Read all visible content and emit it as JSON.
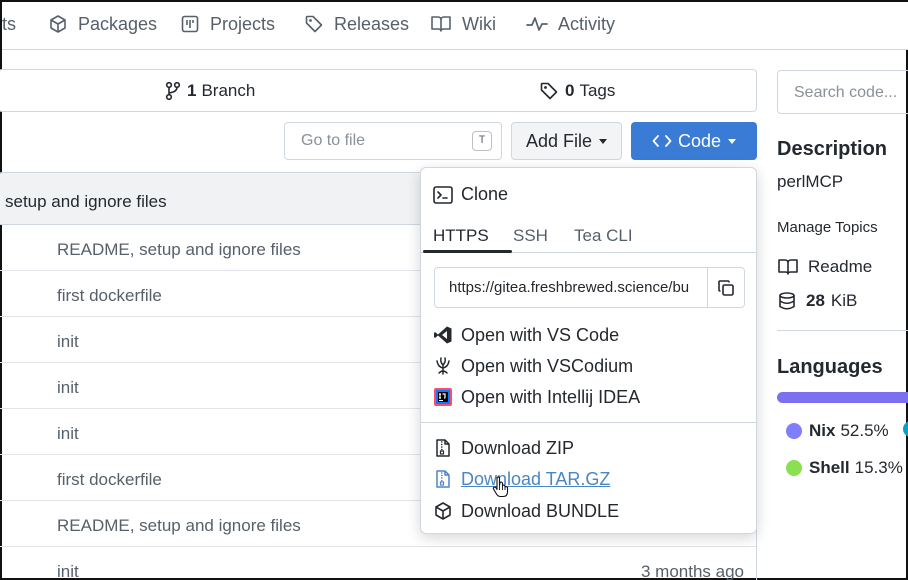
{
  "nav": {
    "items": [
      {
        "label": "ts",
        "icon": "code-icon"
      },
      {
        "label": "Packages",
        "icon": "package-icon"
      },
      {
        "label": "Projects",
        "icon": "project-icon"
      },
      {
        "label": "Releases",
        "icon": "tag-icon"
      },
      {
        "label": "Wiki",
        "icon": "book-icon"
      },
      {
        "label": "Activity",
        "icon": "pulse-icon"
      }
    ]
  },
  "refs": {
    "branch_count": "1",
    "branch_label": "Branch",
    "tag_count": "0",
    "tag_label": "Tags"
  },
  "toolbar": {
    "goto_placeholder": "Go to file",
    "goto_shortcut": "T",
    "add_file_label": "Add File",
    "code_label": "Code"
  },
  "files": {
    "header_message": "setup and ignore files",
    "rows": [
      {
        "message": "README, setup and ignore files",
        "age": ""
      },
      {
        "message": "first dockerfile",
        "age": ""
      },
      {
        "message": "init",
        "age": ""
      },
      {
        "message": "init",
        "age": ""
      },
      {
        "message": "init",
        "age": ""
      },
      {
        "message": "first dockerfile",
        "age": ""
      },
      {
        "message": "README, setup and ignore files",
        "age": ""
      },
      {
        "message": "init",
        "age": "3 months ago"
      }
    ]
  },
  "clone": {
    "title": "Clone",
    "tabs": [
      "HTTPS",
      "SSH",
      "Tea CLI"
    ],
    "active_tab": "HTTPS",
    "url": "https://gitea.freshbrewed.science/bu",
    "open_items": [
      {
        "label": "Open with VS Code",
        "icon": "vscode-icon"
      },
      {
        "label": "Open with VSCodium",
        "icon": "vscodium-icon"
      },
      {
        "label": "Open with Intellij IDEA",
        "icon": "intellij-icon"
      }
    ],
    "download_items": [
      {
        "label": "Download ZIP",
        "icon": "file-zip-icon"
      },
      {
        "label": "Download TAR.GZ",
        "icon": "file-zip-icon"
      },
      {
        "label": "Download BUNDLE",
        "icon": "package-icon"
      }
    ]
  },
  "sidebar": {
    "search_placeholder": "Search code...",
    "description_title": "Description",
    "description_text": "perlMCP",
    "manage_topics": "Manage Topics",
    "readme_label": "Readme",
    "size_value": "28",
    "size_unit": "KiB",
    "languages_title": "Languages",
    "languages": [
      {
        "name": "Nix",
        "percent": "52.5%",
        "color": "#7e7eff"
      },
      {
        "name": "Shell",
        "percent": "15.3%",
        "color": "#89e051"
      }
    ]
  }
}
